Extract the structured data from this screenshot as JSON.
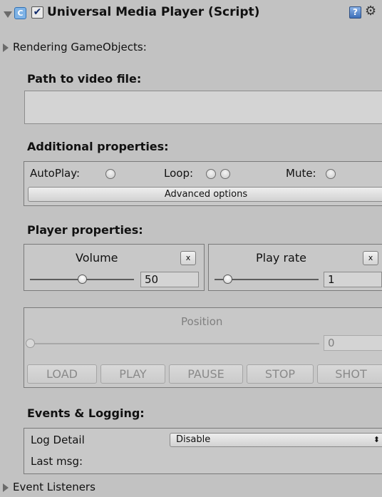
{
  "header": {
    "title": "Universal Media Player (Script)",
    "enabled_checkmark": "✔",
    "settings_glyph": "⚙"
  },
  "rendering_gameobjects_label": "Rendering GameObjects:",
  "path": {
    "title": "Path to video file:",
    "value": ""
  },
  "additional": {
    "title": "Additional properties:",
    "autoplay_label": "AutoPlay:",
    "loop_label": "Loop:",
    "mute_label": "Mute:",
    "advanced_button": "Advanced options"
  },
  "player": {
    "title": "Player properties:",
    "volume_label": "Volume",
    "volume_value": "50",
    "volume_reset": "x",
    "playrate_label": "Play rate",
    "playrate_value": "1",
    "playrate_reset": "x"
  },
  "position": {
    "label": "Position",
    "value": "0"
  },
  "controls": {
    "load": "LOAD",
    "play": "PLAY",
    "pause": "PAUSE",
    "stop": "STOP",
    "shot": "SHOT"
  },
  "events": {
    "title": "Events & Logging:",
    "log_detail_label": "Log Detail",
    "log_detail_value": "Disable",
    "dropdown_glyph": "⬍",
    "last_msg_label": "Last msg:",
    "last_msg_value": ""
  },
  "event_listeners_label": "Event Listeners"
}
